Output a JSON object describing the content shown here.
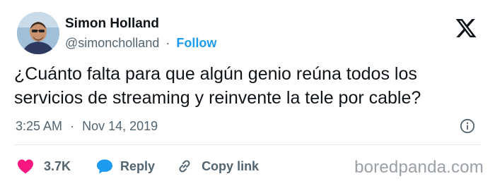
{
  "author": {
    "name": "Simon Holland",
    "handle": "@simoncholland",
    "separator": "·",
    "follow_label": "Follow"
  },
  "tweet": {
    "text": "¿Cuánto falta para que algún genio reúna todos los servicios de streaming y reinvente la tele por cable?",
    "time": "3:25 AM",
    "date": "Nov 14, 2019"
  },
  "actions": {
    "like_count": "3.7K",
    "reply_label": "Reply",
    "copy_link_label": "Copy link"
  },
  "watermark": "boredpanda.com",
  "colors": {
    "text": "#0f1419",
    "secondary": "#536471",
    "accent": "#1d9bf0",
    "like": "#f91880"
  },
  "icons": [
    "x-logo-icon",
    "info-icon",
    "heart-icon",
    "reply-bubble-icon",
    "link-icon"
  ]
}
